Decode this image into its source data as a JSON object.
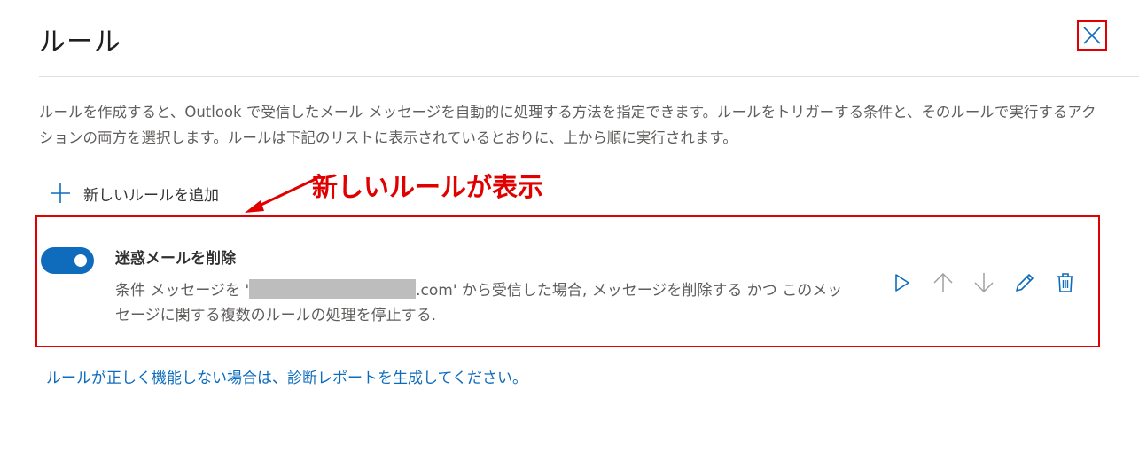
{
  "dialog": {
    "title": "ルール",
    "close_icon": "close-icon"
  },
  "description": "ルールを作成すると、Outlook で受信したメール メッセージを自動的に処理する方法を指定できます。ルールをトリガーする条件と、そのルールで実行するアクションの両方を選択します。ルールは下記のリストに表示されているとおりに、上から順に実行されます。",
  "add_rule": {
    "label": "新しいルールを追加",
    "icon": "plus-icon"
  },
  "annotation": {
    "text": "新しいルールが表示",
    "color": "#e00000"
  },
  "rule": {
    "enabled": true,
    "name": "迷惑メールを削除",
    "desc_before": "条件 メッセージを '",
    "desc_after": ".com' から受信した場合, メッセージを削除する かつ このメッセージに関する複数のルールの処理を停止する.",
    "actions": [
      "play-icon",
      "arrow-up-icon",
      "arrow-down-icon",
      "pencil-icon",
      "trash-icon"
    ]
  },
  "footer_link": "ルールが正しく機能しない場合は、診断レポートを生成してください。",
  "colors": {
    "accent": "#0f6cbd",
    "annotation_red": "#e00000",
    "disabled_icon": "#a19f9d"
  }
}
